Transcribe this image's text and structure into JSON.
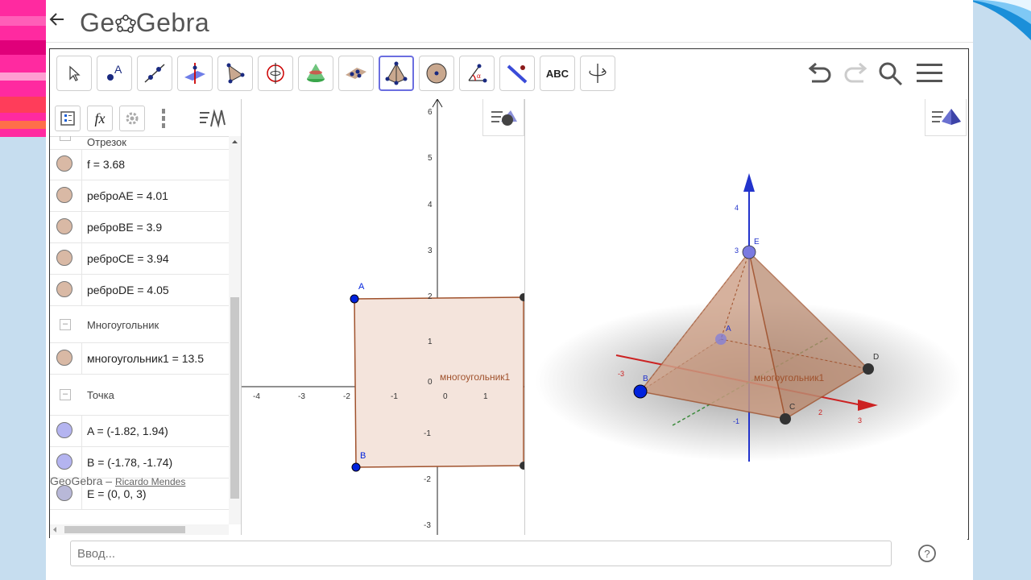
{
  "app": {
    "back_icon": "arrow-left-icon",
    "logo_text_left": "Ge",
    "logo_text_right": "Gebra",
    "logo_icon": "geogebra-logo-icon"
  },
  "toolbar": {
    "tools": [
      {
        "name": "move-tool",
        "icon": "cursor-arrow-icon"
      },
      {
        "name": "point-tool",
        "icon": "point-a-icon",
        "label": "A"
      },
      {
        "name": "line-tool",
        "icon": "line-icon"
      },
      {
        "name": "perpendicular-tool",
        "icon": "perpendicular-plane-icon"
      },
      {
        "name": "polygon-tool",
        "icon": "triangle-icon"
      },
      {
        "name": "circle-axis-tool",
        "icon": "circle-axis-icon"
      },
      {
        "name": "intersect-tool",
        "icon": "cone-icon"
      },
      {
        "name": "plane-tool",
        "icon": "plane-points-icon"
      },
      {
        "name": "pyramid-tool",
        "icon": "pyramid-icon"
      },
      {
        "name": "sphere-tool",
        "icon": "sphere-icon"
      },
      {
        "name": "angle-tool",
        "icon": "angle-alpha-icon",
        "label": "α"
      },
      {
        "name": "reflect-tool",
        "icon": "reflect-icon"
      },
      {
        "name": "text-tool",
        "icon": "text-abc-icon",
        "label": "ABC"
      },
      {
        "name": "rotate-view-tool",
        "icon": "rotate-3d-icon"
      }
    ],
    "active_index": 8,
    "right_icons": [
      "undo-icon",
      "redo-icon",
      "search-icon",
      "menu-icon"
    ]
  },
  "algebra": {
    "header_icons": [
      "algebra-view-icon",
      "fx-icon",
      "gear-icon",
      "more-vertical-icon",
      "sort-icon"
    ],
    "fx_label": "fx",
    "partial_group": "Отрезок",
    "rows": [
      {
        "type": "item",
        "text": "f = 3.68",
        "color": "#d9b9a5"
      },
      {
        "type": "item",
        "text": "реброAE = 4.01",
        "color": "#d9b9a5"
      },
      {
        "type": "item",
        "text": "реброBE = 3.9",
        "color": "#d9b9a5"
      },
      {
        "type": "item",
        "text": "реброCE = 3.94",
        "color": "#d9b9a5"
      },
      {
        "type": "item",
        "text": "реброDE = 4.05",
        "color": "#d9b9a5"
      },
      {
        "type": "group",
        "text": "Многоугольник"
      },
      {
        "type": "item",
        "text": "многоугольник1 = 13.5",
        "color": "#d9b9a5"
      },
      {
        "type": "group",
        "text": "Точка"
      },
      {
        "type": "item",
        "text": "A = (-1.82, 1.94)",
        "color": "#b4b4f0"
      },
      {
        "type": "item",
        "text": "B = (-1.78, -1.74)",
        "color": "#b4b4f0"
      },
      {
        "type": "item",
        "text": "E = (0, 0, 3)",
        "color": "#b8b8d8"
      }
    ],
    "credit_logo": "GeoGebra",
    "credit_author": "Ricardo Mendes",
    "credit_sep": " – "
  },
  "view2d": {
    "style_icon": "graphics-style-icon",
    "x_ticks": [
      "-4",
      "-3",
      "-2",
      "-1",
      "0",
      "1"
    ],
    "y_ticks": [
      "6",
      "5",
      "4",
      "3",
      "2",
      "1",
      "0",
      "-1",
      "-2",
      "-3"
    ],
    "point_a_label": "A",
    "point_b_label": "B",
    "polygon_label": "многоугольник1"
  },
  "view3d": {
    "style_icon": "graphics3d-style-icon",
    "labels": {
      "E": "E",
      "A": "A",
      "B": "B",
      "C": "C",
      "D": "D",
      "polygon": "многоугольник1"
    },
    "z_ticks": [
      "4",
      "3"
    ],
    "bottom_ticks": [
      "-1",
      "2",
      "3",
      "-3"
    ]
  },
  "input": {
    "placeholder": "Ввод...",
    "help_icon": "help-circle-icon",
    "help_glyph": "?"
  },
  "colors": {
    "polygon_fill": "#f4e4dc",
    "polygon_stroke": "#a0522d",
    "point_blue": "#0022dd",
    "point_dark": "#333333",
    "active_tool_border": "#6b6ee0"
  }
}
